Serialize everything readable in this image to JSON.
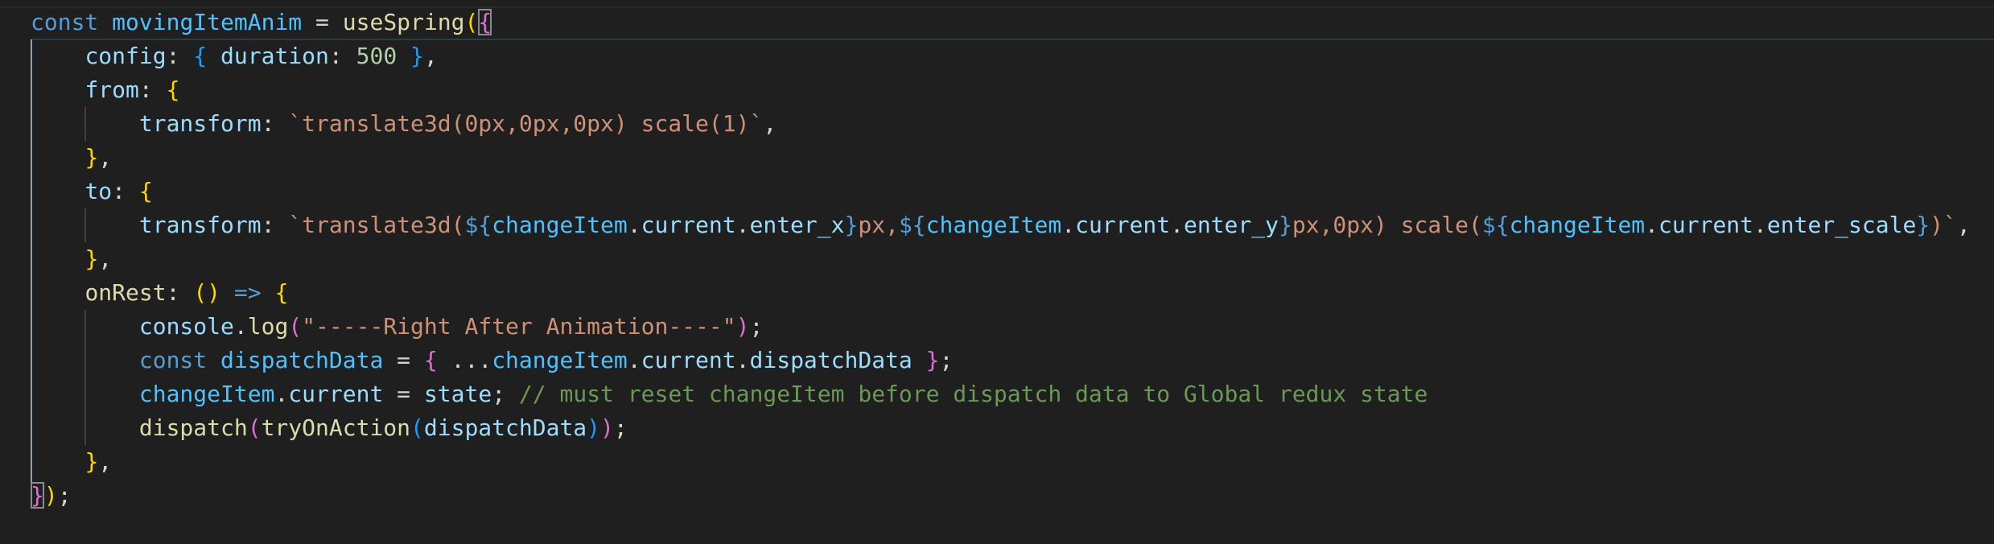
{
  "editor": {
    "theme_background": "#1f1f1f",
    "lines": [
      "const movingItemAnim = useSpring({",
      "    config: { duration: 500 },",
      "    from: {",
      "        transform: `translate3d(0px,0px,0px) scale(1)`,",
      "    },",
      "    to: {",
      "        transform: `translate3d(${changeItem.current.enter_x}px,${changeItem.current.enter_y}px,0px) scale(${changeItem.current.enter_scale})`,",
      "    },",
      "    onRest: () => {",
      "        console.log(\"-----Right After Animation----\");",
      "        const dispatchData = { ...changeItem.current.dispatchData };",
      "        changeItem.current = state; // must reset changeItem before dispatch data to Global redux state",
      "        dispatch(tryOnAction(dispatchData));",
      "    },",
      "});"
    ]
  }
}
